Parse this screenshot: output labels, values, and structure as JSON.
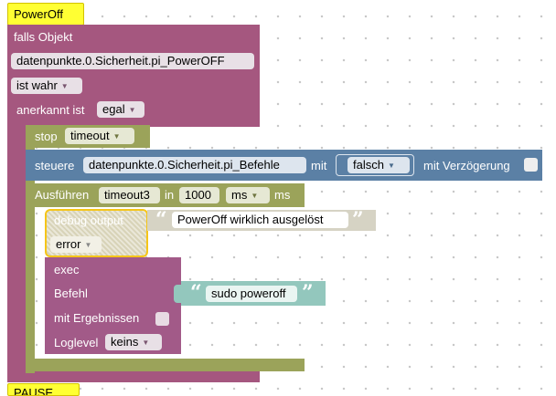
{
  "hat": {
    "label": "PowerOff"
  },
  "hat_bottom": {
    "label": "PAUSE"
  },
  "trigger": {
    "header": "falls Objekt",
    "object": "datenpunkte.0.Sicherheit.pi_PowerOFF",
    "condition": "ist wahr",
    "ack_label": "anerkannt ist",
    "ack_value": "egal"
  },
  "stop": {
    "label": "stop",
    "value": "timeout"
  },
  "control": {
    "label": "steuere",
    "object": "datenpunkte.0.Sicherheit.pi_Befehle",
    "with_label": "mit",
    "value": "falsch",
    "delay_label": "mit Verzögerung"
  },
  "timeout": {
    "label": "Ausführen",
    "name": "timeout3",
    "in_label": "in",
    "value": "1000",
    "unit": "ms",
    "unit_suffix": "ms"
  },
  "debug": {
    "label": "debug output",
    "text": "PowerOff wirklich ausgelöst",
    "level": "error"
  },
  "exec": {
    "label": "exec",
    "command_label": "Befehl",
    "command": "sudo poweroff",
    "results_label": "mit Ergebnissen",
    "loglevel_label": "Loglevel",
    "loglevel": "keins"
  },
  "colors": {
    "trigger": "#a5577f",
    "stop": "#9ba35a",
    "control": "#5b80a5",
    "debug": "#c9c9ad",
    "text": "#93c7bd",
    "hat": "#ffff33"
  }
}
